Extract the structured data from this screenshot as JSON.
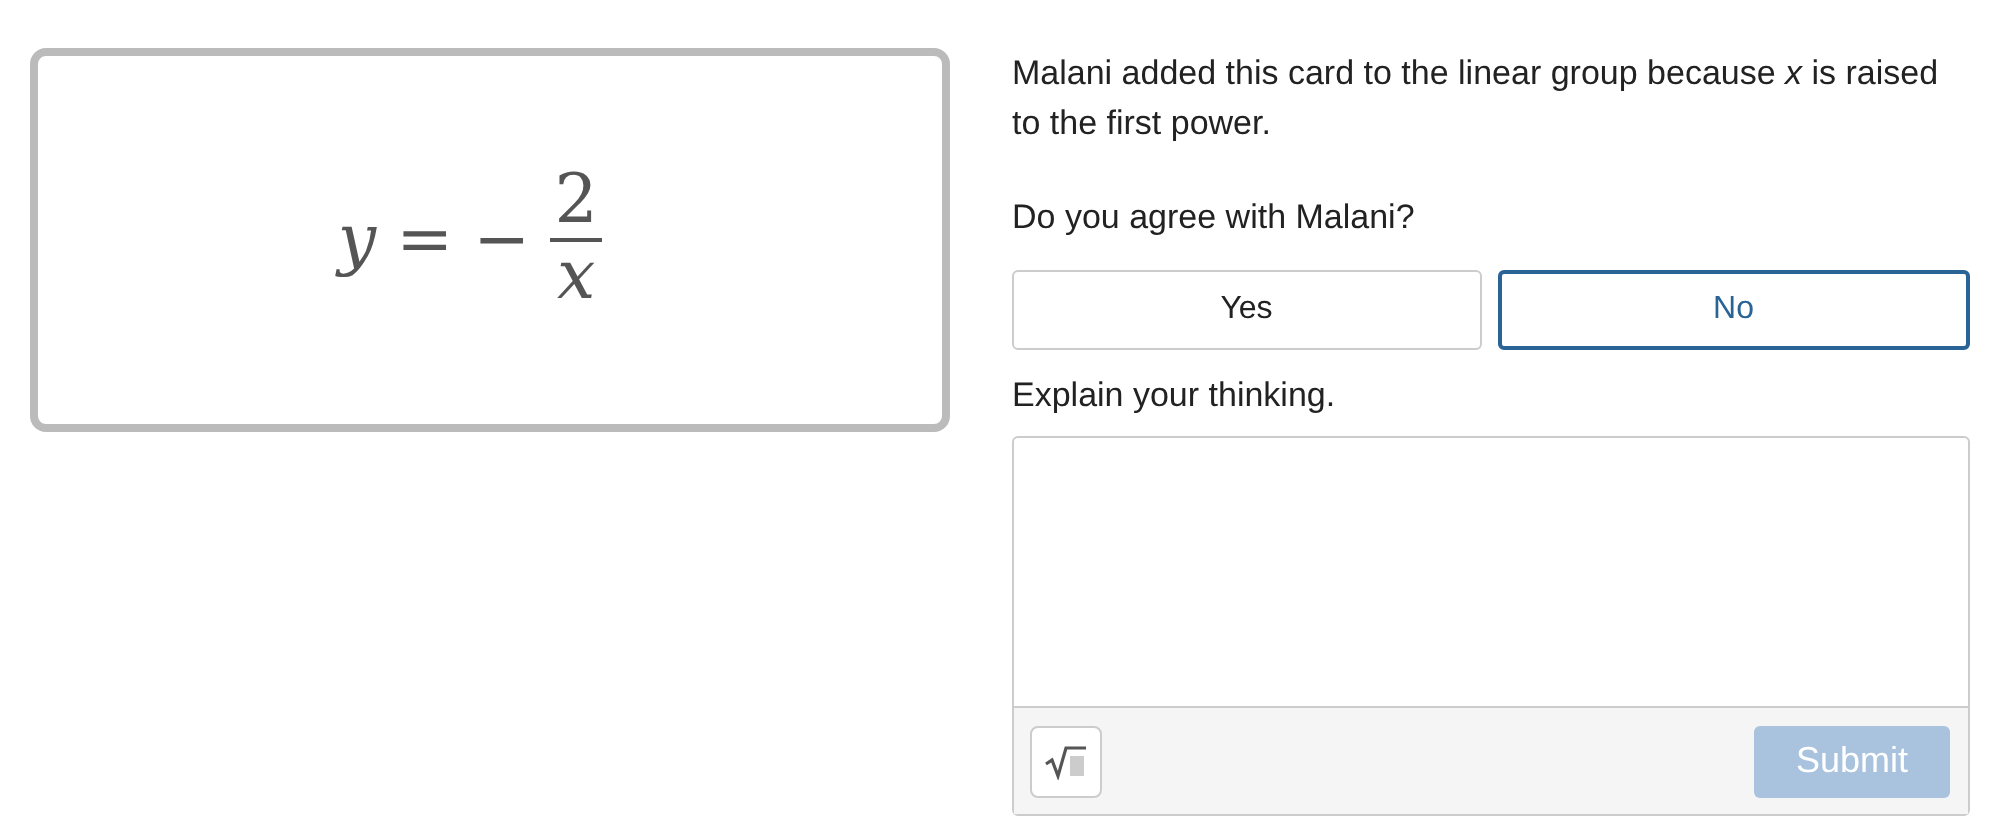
{
  "card": {
    "equation": {
      "lhs": "y",
      "relation": "=",
      "sign": "−",
      "numerator": "2",
      "denominator": "x"
    }
  },
  "prompt": "Malani added this card to the linear group because *x* is raised to the first power.",
  "question": "Do you agree with Malani?",
  "choices": [
    {
      "label": "Yes",
      "selected": false
    },
    {
      "label": "No",
      "selected": true
    }
  ],
  "explain_label": "Explain your thinking.",
  "answer": {
    "submit": {
      "label": "Submit",
      "disabled": true
    }
  }
}
